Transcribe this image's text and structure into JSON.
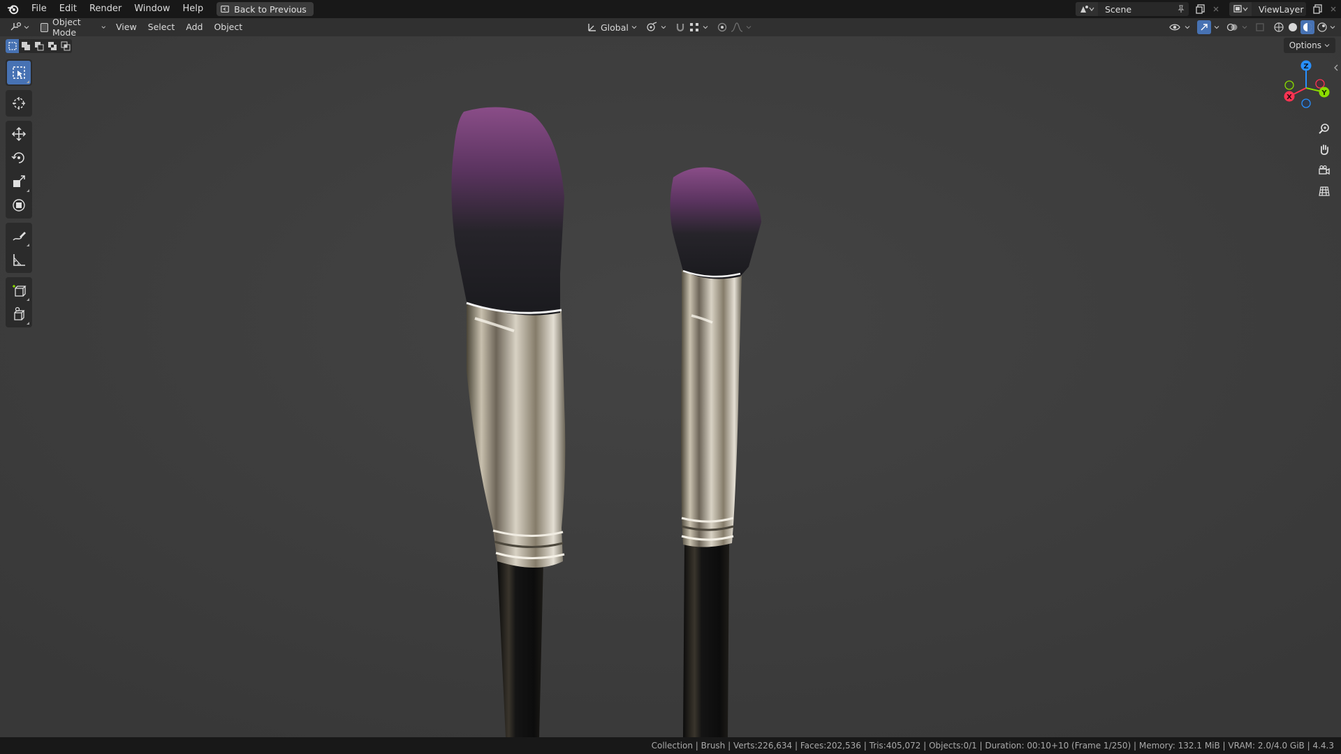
{
  "topbar": {
    "menus": [
      "File",
      "Edit",
      "Render",
      "Window",
      "Help"
    ],
    "back_button": "Back to Previous",
    "scene_name": "Scene",
    "view_layer_name": "ViewLayer"
  },
  "header": {
    "mode": "Object Mode",
    "menus": [
      "View",
      "Select",
      "Add",
      "Object"
    ],
    "transform_orientation": "Global"
  },
  "viewport": {
    "options_label": "Options",
    "selection_modes": [
      "set",
      "extend",
      "subtract",
      "difference",
      "intersect"
    ],
    "active_tool": "select-box",
    "tools": [
      {
        "name": "select-box",
        "group": 1
      },
      {
        "name": "cursor",
        "group": 2
      },
      {
        "name": "move",
        "group": 3
      },
      {
        "name": "rotate",
        "group": 3
      },
      {
        "name": "scale",
        "group": 3
      },
      {
        "name": "transform",
        "group": 3
      },
      {
        "name": "annotate",
        "group": 4
      },
      {
        "name": "measure",
        "group": 4
      },
      {
        "name": "add-cube",
        "group": 5
      },
      {
        "name": "add-object",
        "group": 5
      }
    ],
    "gizmo_axes": {
      "x": "X",
      "y": "Y",
      "z": "Z"
    },
    "axis_colors": {
      "x": "#ff3352",
      "y": "#8bdc00",
      "z": "#2890ff"
    },
    "nav_buttons": [
      "zoom",
      "pan",
      "camera",
      "ortho-toggle"
    ]
  },
  "scene": {
    "background": "#3d3d3d",
    "bristle_tip_color": "#8a4d88",
    "bristle_base_color": "#1e1e22",
    "handle_color": "#0f0f0f",
    "ferrule_color": "#b8b0a0"
  },
  "statusbar": {
    "text": "Collection | Brush | Verts:226,634 | Faces:202,536 | Tris:405,072 | Objects:0/1 | Duration: 00:10+10 (Frame 1/250) | Memory: 132.1 MiB | VRAM: 2.0/4.0 GiB | 4.4.3"
  }
}
